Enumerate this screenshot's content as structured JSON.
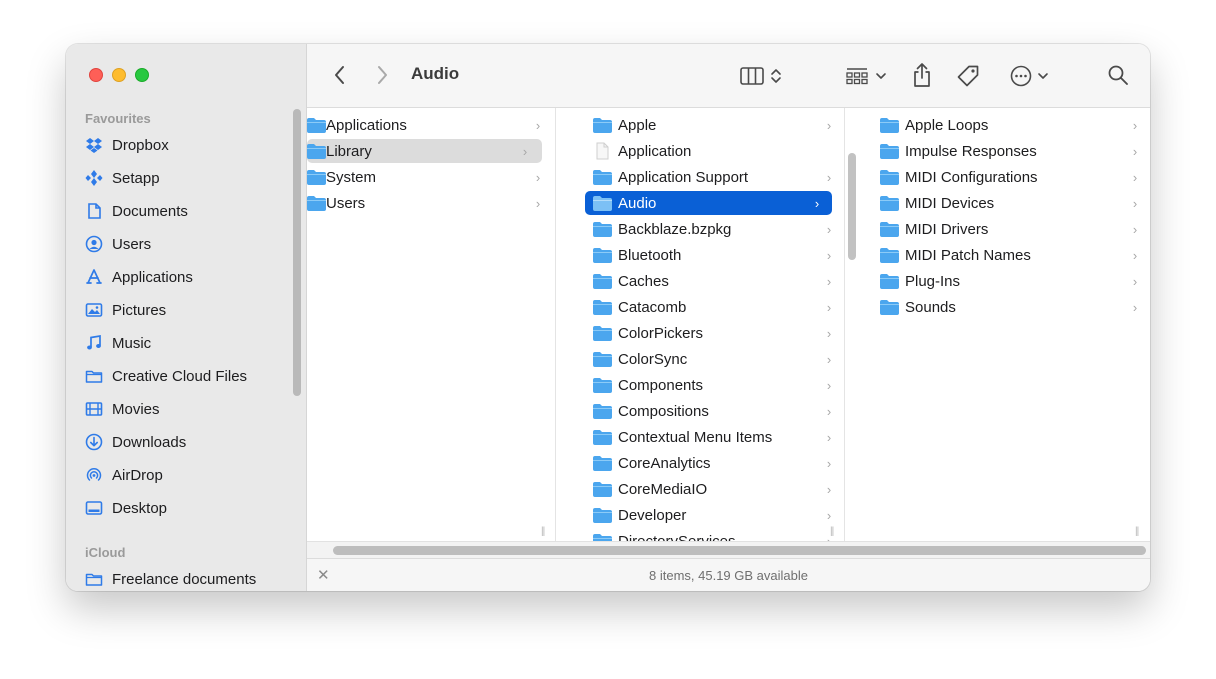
{
  "toolbar": {
    "back_icon": "chevron-left-icon",
    "forward_icon": "chevron-right-icon",
    "title": "Audio",
    "view_icon": "column-view-icon",
    "group_icon": "grid-group-icon",
    "share_icon": "share-icon",
    "tag_icon": "tag-icon",
    "more_icon": "ellipsis-circle-icon",
    "search_icon": "search-icon"
  },
  "sidebar": {
    "favourites_label": "Favourites",
    "icloud_label": "iCloud",
    "items": [
      {
        "label": "Dropbox",
        "icon": "dropbox-icon"
      },
      {
        "label": "Setapp",
        "icon": "setapp-icon"
      },
      {
        "label": "Documents",
        "icon": "document-icon"
      },
      {
        "label": "Users",
        "icon": "user-icon"
      },
      {
        "label": "Applications",
        "icon": "applications-icon"
      },
      {
        "label": "Pictures",
        "icon": "pictures-icon"
      },
      {
        "label": "Music",
        "icon": "music-icon"
      },
      {
        "label": "Creative Cloud Files",
        "icon": "folder-icon"
      },
      {
        "label": "Movies",
        "icon": "movies-icon"
      },
      {
        "label": "Downloads",
        "icon": "downloads-icon"
      },
      {
        "label": "AirDrop",
        "icon": "airdrop-icon"
      },
      {
        "label": "Desktop",
        "icon": "desktop-icon"
      }
    ],
    "icloud_items": [
      {
        "label": "Freelance documents",
        "icon": "folder-icon"
      }
    ]
  },
  "columns": {
    "col1": [
      {
        "label": "Applications"
      },
      {
        "label": "Library",
        "state": "selected-inactive"
      },
      {
        "label": "System"
      },
      {
        "label": "Users"
      }
    ],
    "col2": [
      {
        "label": "Apple",
        "type": "folder"
      },
      {
        "label": "Application",
        "type": "file"
      },
      {
        "label": "Application Support",
        "type": "folder"
      },
      {
        "label": "Audio",
        "type": "folder",
        "state": "selected-active"
      },
      {
        "label": "Backblaze.bzpkg",
        "type": "folder"
      },
      {
        "label": "Bluetooth",
        "type": "folder"
      },
      {
        "label": "Caches",
        "type": "folder"
      },
      {
        "label": "Catacomb",
        "type": "folder"
      },
      {
        "label": "ColorPickers",
        "type": "folder"
      },
      {
        "label": "ColorSync",
        "type": "folder"
      },
      {
        "label": "Components",
        "type": "folder"
      },
      {
        "label": "Compositions",
        "type": "folder"
      },
      {
        "label": "Contextual Menu Items",
        "type": "folder"
      },
      {
        "label": "CoreAnalytics",
        "type": "folder"
      },
      {
        "label": "CoreMediaIO",
        "type": "folder"
      },
      {
        "label": "Developer",
        "type": "folder"
      },
      {
        "label": "DirectoryServices",
        "type": "folder"
      }
    ],
    "col3": [
      {
        "label": "Apple Loops"
      },
      {
        "label": "Impulse Responses"
      },
      {
        "label": "MIDI Configurations"
      },
      {
        "label": "MIDI Devices"
      },
      {
        "label": "MIDI Drivers"
      },
      {
        "label": "MIDI Patch Names"
      },
      {
        "label": "Plug-Ins"
      },
      {
        "label": "Sounds"
      }
    ]
  },
  "status": {
    "text": "8 items, 45.19 GB available"
  },
  "colors": {
    "accent": "#0a60d6",
    "folder": "#4ba6ee",
    "sidebar_icon": "#2f7be8"
  }
}
